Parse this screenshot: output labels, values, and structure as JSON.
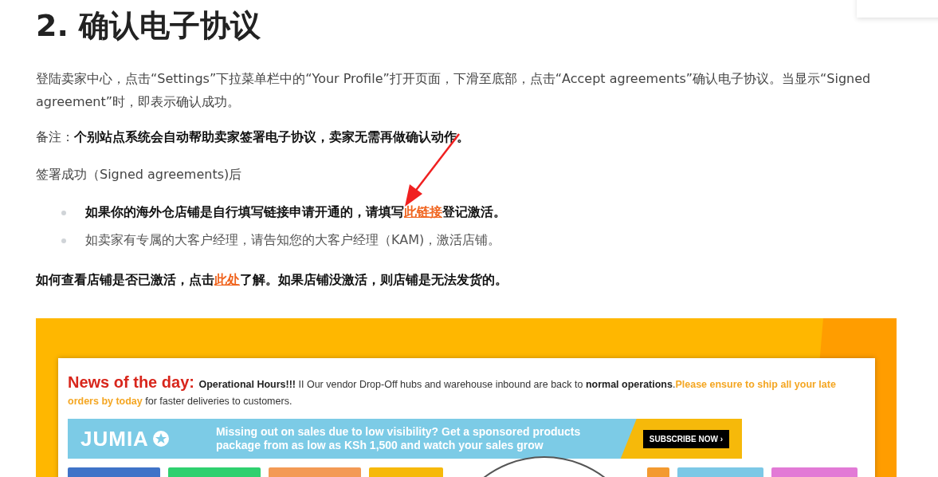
{
  "heading": "2. 确认电子协议",
  "intro": "登陆卖家中心，点击“Settings”下拉菜单栏中的“Your Profile”打开页面，下滑至底部，点击“Accept agreements”确认电子协议。当显示“Signed agreement”时，即表示确认成功。",
  "note": "备注：**个别站点系统会自动帮助卖家签署电子协议，卖家无需再做确认动作。**",
  "signed_line": "签署成功（Signed agreements)后",
  "bullets": [
    {
      "bold": true,
      "parts": [
        {
          "kind": "text",
          "text": "如果你的海外仓店铺是自行填写链接申请开通的，请填写"
        },
        {
          "kind": "link",
          "text": "此链接"
        },
        {
          "kind": "text",
          "text": "登记激活。"
        }
      ]
    },
    {
      "bold": false,
      "parts": [
        {
          "kind": "text",
          "text": "如卖家有专属的大客户经理，请告知您的大客户经理（KAM)，激活店铺。"
        }
      ]
    }
  ],
  "check_line": [
    {
      "kind": "text",
      "text": "如何查看店铺是否已激活，点击"
    },
    {
      "kind": "link",
      "text": "此处"
    },
    {
      "kind": "text",
      "text": "了解。如果店铺没激活，则店铺是无法发货的。"
    }
  ],
  "screenshot": {
    "news": [
      {
        "kind": "title",
        "text": "News of the day: "
      },
      {
        "kind": "bold",
        "text": "Operational Hours!!! "
      },
      {
        "kind": "text",
        "text": "II Our vendor Drop-Off hubs and warehouse inbound are back to "
      },
      {
        "kind": "bold",
        "text": "normal operations"
      },
      {
        "kind": "text",
        "text": "."
      },
      {
        "kind": "highlight",
        "text": "Please ensure to ship all your late orders by today"
      },
      {
        "kind": "text",
        "text": " for faster deliveries to customers."
      }
    ],
    "banner": {
      "logo": "JUMIA",
      "message": "Missing out on sales due to low visibility? Get a sponsored products package from as low as KSh 1,500 and watch your sales grow",
      "button": "SUBSCRIBE NOW ›"
    },
    "tiles": [
      {
        "color": "#3f73c8"
      },
      {
        "color": "#2fd06f"
      },
      {
        "color": "#f39a55"
      },
      {
        "color": "#f6b90a"
      },
      {
        "color": "#f39a30"
      },
      {
        "color": "#7cc8e6"
      },
      {
        "color": "#e27ad6"
      }
    ]
  }
}
